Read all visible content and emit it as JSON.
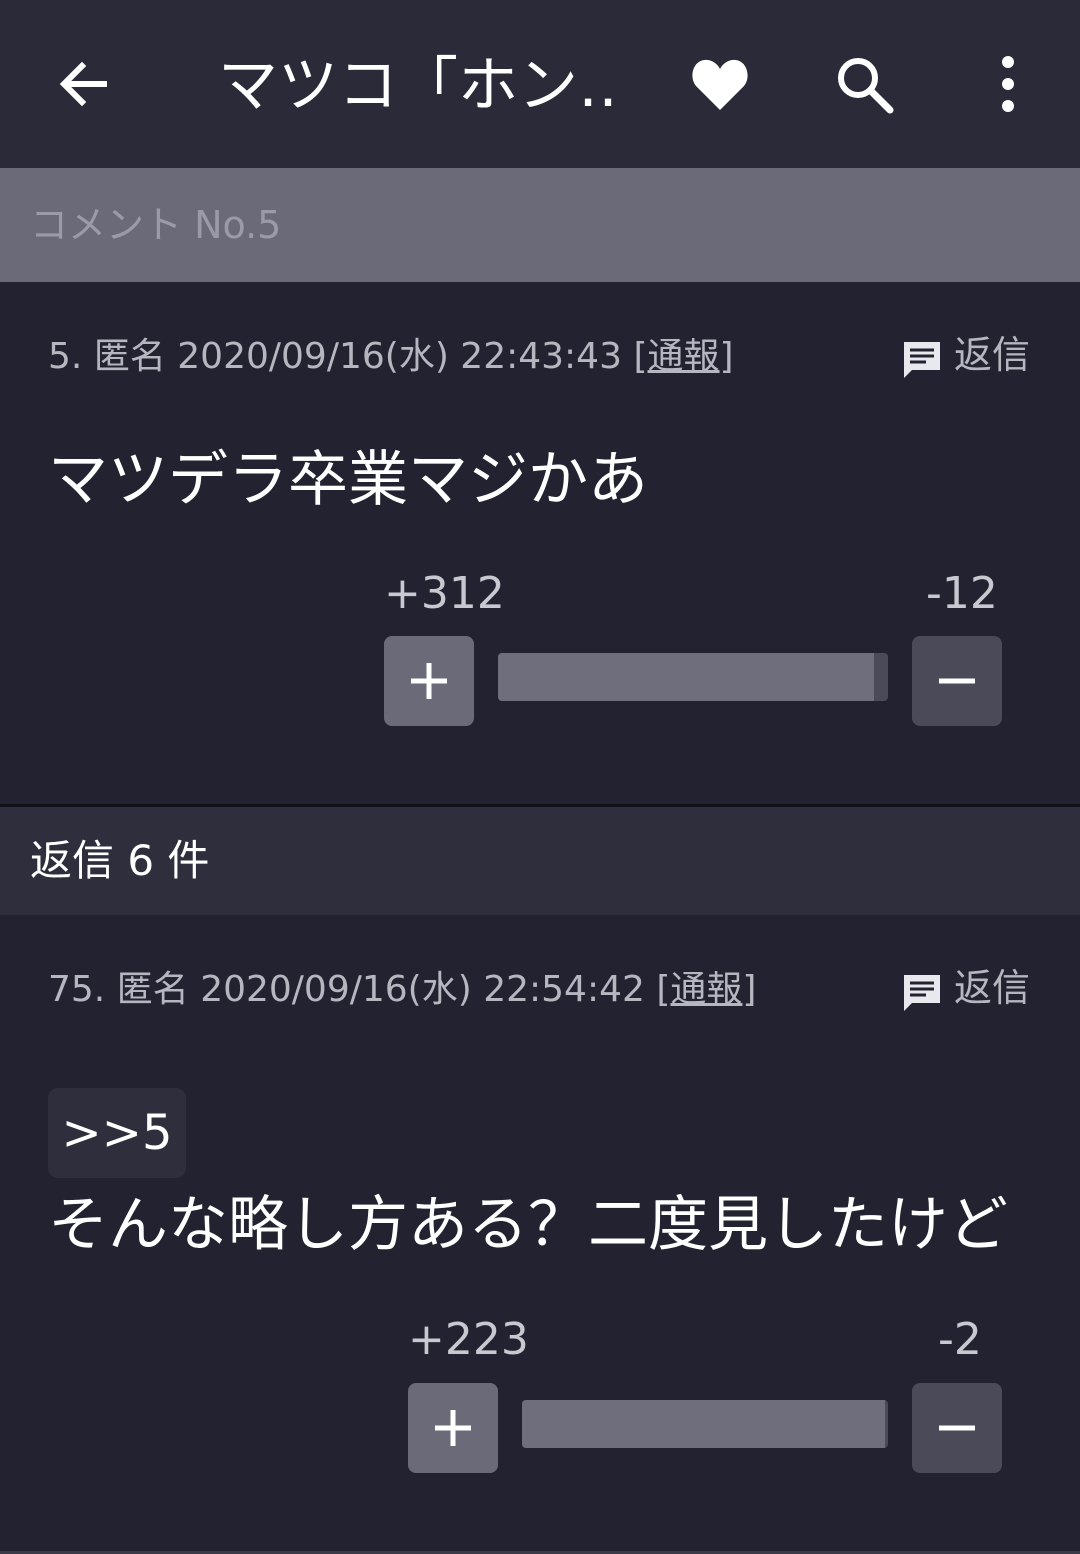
{
  "appbar": {
    "title": "マツコ「ホン…",
    "icons": {
      "back": "arrow-left-icon",
      "favorite": "heart-icon",
      "search": "search-icon",
      "more": "more-vertical-icon"
    }
  },
  "section": {
    "label": "コメント No.5"
  },
  "comments": [
    {
      "number": "5.",
      "author": "匿名",
      "timestamp": "2020/09/16(水) 22:43:43",
      "report": "[通報]",
      "reply_label": "返信",
      "body": "マツデラ卒業マジかあ",
      "plus_score": "+312",
      "minus_score": "-12",
      "ratio": 0.963
    },
    {
      "number": "75.",
      "author": "匿名",
      "timestamp": "2020/09/16(水) 22:54:42",
      "report": "[通報]",
      "reply_label": "返信",
      "quote": ">>5",
      "body": "そんな略し方ある？二度見したけど",
      "plus_score": "+223",
      "minus_score": "-2",
      "ratio": 0.991
    }
  ],
  "replies": {
    "label": "返信 6 件"
  },
  "colors": {
    "background": "#222230",
    "appbar": "#2a2a38",
    "section": "#6a6a78",
    "accent_text": "#ffffff"
  }
}
